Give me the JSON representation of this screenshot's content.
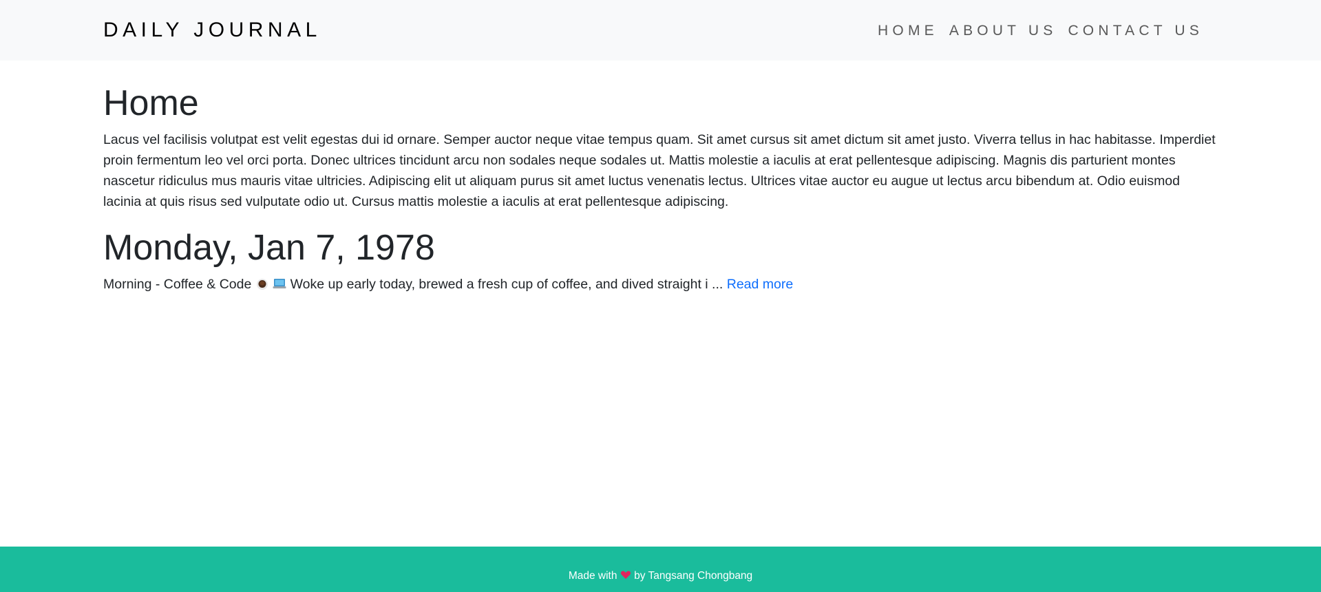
{
  "header": {
    "brand": "DAILY JOURNAL",
    "nav": [
      {
        "label": "HOME"
      },
      {
        "label": "ABOUT US"
      },
      {
        "label": "CONTACT US"
      }
    ]
  },
  "main": {
    "title": "Home",
    "intro": "Lacus vel facilisis volutpat est velit egestas dui id ornare. Semper auctor neque vitae tempus quam. Sit amet cursus sit amet dictum sit amet justo. Viverra tellus in hac habitasse. Imperdiet proin fermentum leo vel orci porta. Donec ultrices tincidunt arcu non sodales neque sodales ut. Mattis molestie a iaculis at erat pellentesque adipiscing. Magnis dis parturient montes nascetur ridiculus mus mauris vitae ultricies. Adipiscing elit ut aliquam purus sit amet luctus venenatis lectus. Ultrices vitae auctor eu augue ut lectus arcu bibendum at. Odio euismod lacinia at quis risus sed vulputate odio ut. Cursus mattis molestie a iaculis at erat pellentesque adipiscing.",
    "posts": [
      {
        "date": "Monday, Jan 7, 1978",
        "excerpt_start": "Morning - Coffee & Code",
        "excerpt_end": "Woke up early today, brewed a fresh cup of coffee, and dived straight i ...",
        "read_more": "Read more"
      }
    ]
  },
  "footer": {
    "made_with": "Made with",
    "by": "by Tangsang Chongbang"
  },
  "icons": {
    "coffee": "coffee-icon",
    "laptop": "laptop-icon",
    "heart": "heart-icon"
  },
  "colors": {
    "navbar_bg": "#f8f9fa",
    "footer_bg": "#1abc9c",
    "link": "#0d6efd"
  }
}
